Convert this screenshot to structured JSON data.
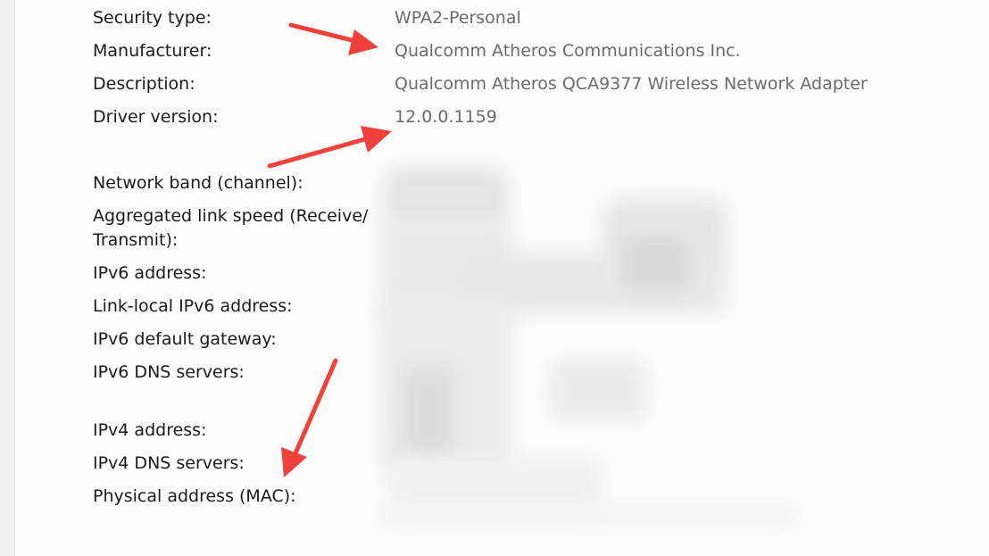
{
  "properties": {
    "security_type": {
      "label": "Security type:",
      "value": "WPA2-Personal"
    },
    "manufacturer": {
      "label": "Manufacturer:",
      "value": "Qualcomm Atheros Communications Inc."
    },
    "description": {
      "label": "Description:",
      "value": "Qualcomm Atheros QCA9377 Wireless Network Adapter"
    },
    "driver_version": {
      "label": "Driver version:",
      "value": "12.0.0.1159"
    },
    "network_band": {
      "label": "Network band (channel):"
    },
    "link_speed": {
      "label_line1": "Aggregated link speed (Receive/",
      "label_line2": "Transmit):"
    },
    "ipv6_address": {
      "label": "IPv6 address:"
    },
    "link_local_ipv6": {
      "label": "Link-local IPv6 address:"
    },
    "ipv6_gateway": {
      "label": "IPv6 default gateway:"
    },
    "ipv6_dns": {
      "label": "IPv6 DNS servers:"
    },
    "ipv4_address": {
      "label": "IPv4 address:"
    },
    "ipv4_dns": {
      "label": "IPv4 DNS servers:"
    },
    "mac": {
      "label": "Physical address (MAC):"
    }
  },
  "colors": {
    "label_text": "#1b1b1b",
    "value_text": "#6b6b6b",
    "annotation_arrow": "#f0413a",
    "redaction_blur": "#d9d9d9"
  }
}
